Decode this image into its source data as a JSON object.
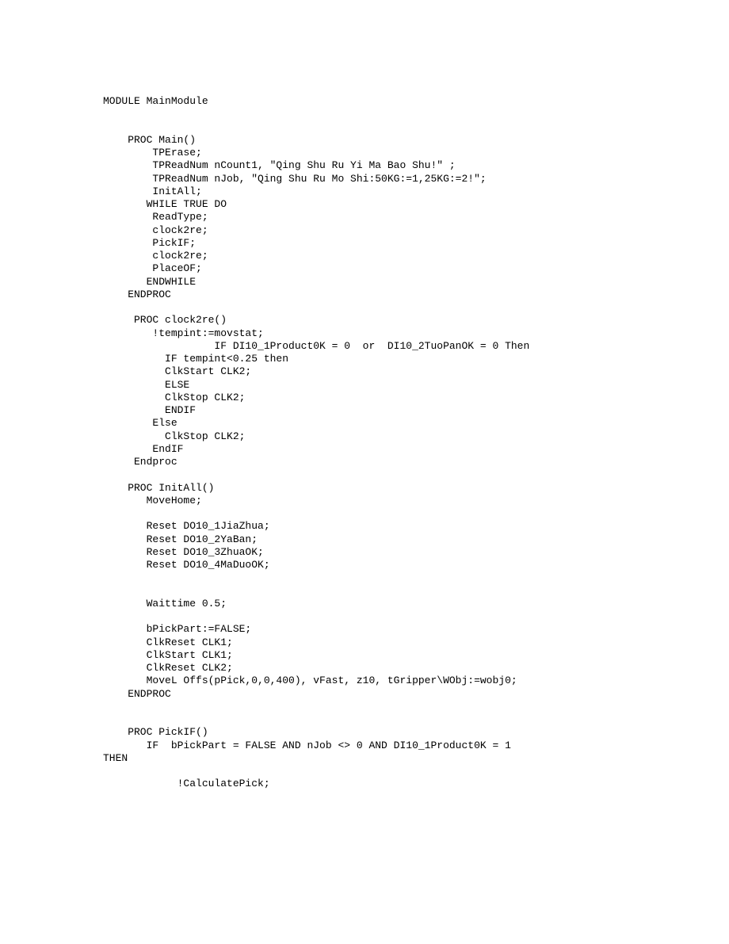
{
  "code": "MODULE MainModule\n\n\n    PROC Main()\n        TPErase;\n        TPReadNum nCount1, \"Qing Shu Ru Yi Ma Bao Shu!\" ;\n        TPReadNum nJob, \"Qing Shu Ru Mo Shi:50KG:=1,25KG:=2!\";\n        InitAll;\n       WHILE TRUE DO\n        ReadType;\n        clock2re;\n        PickIF;\n        clock2re;\n        PlaceOF;\n       ENDWHILE\n    ENDPROC\n\n     PROC clock2re()\n        !tempint:=movstat;\n                  IF DI10_1Product0K = 0  or  DI10_2TuoPanOK = 0 Then\n          IF tempint<0.25 then\n          ClkStart CLK2;\n          ELSE\n          ClkStop CLK2;\n          ENDIF\n        Else\n          ClkStop CLK2;\n        EndIF\n     Endproc\n\n    PROC InitAll()\n       MoveHome;\n\n       Reset DO10_1JiaZhua;\n       Reset DO10_2YaBan;\n       Reset DO10_3ZhuaOK;\n       Reset DO10_4MaDuoOK;\n\n\n       Waittime 0.5;\n\n       bPickPart:=FALSE;\n       ClkReset CLK1;\n       ClkStart CLK1;\n       ClkReset CLK2;\n       MoveL Offs(pPick,0,0,400), vFast, z10, tGripper\\WObj:=wobj0;\n    ENDPROC\n\n\n    PROC PickIF()\n       IF  bPickPart = FALSE AND nJob <> 0 AND DI10_1Product0K = 1\nTHEN\n\n            !CalculatePick;"
}
